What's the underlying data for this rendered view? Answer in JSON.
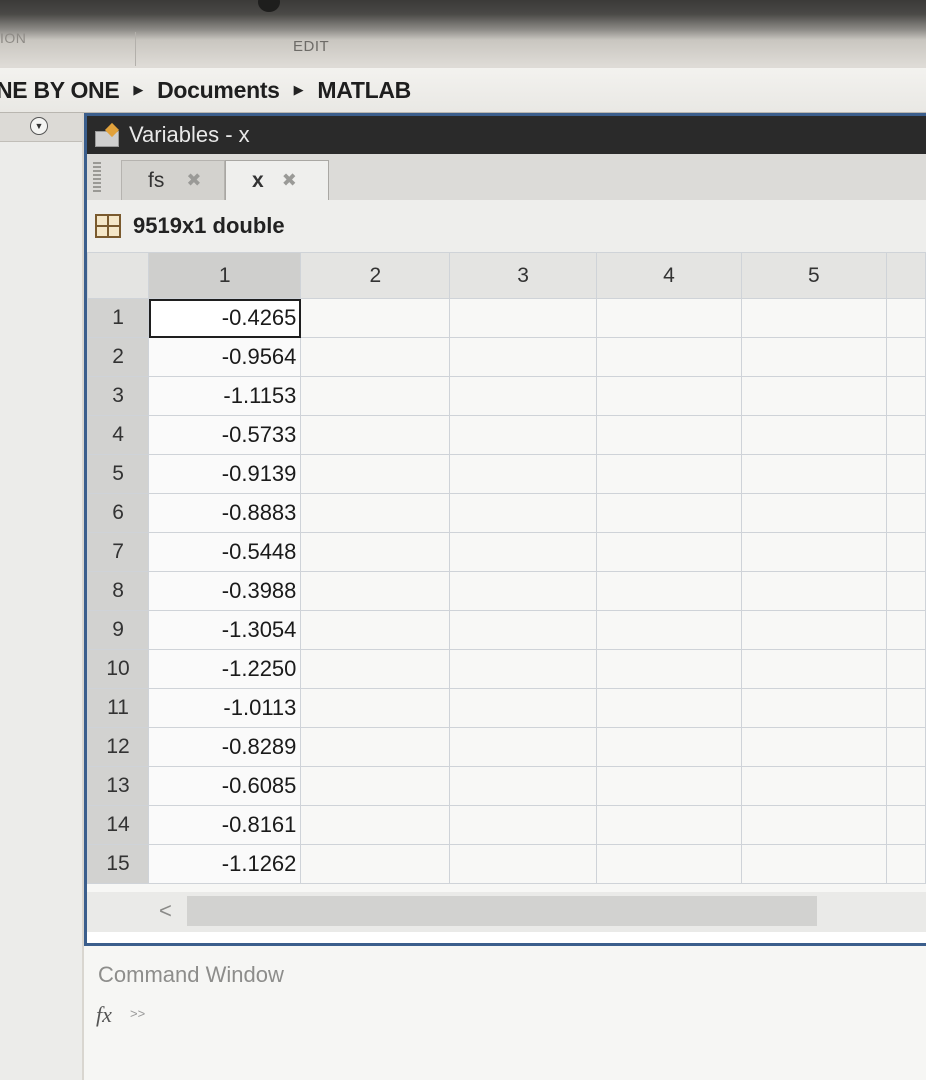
{
  "toolstrip": {
    "section_left": "ION",
    "section_edit": "EDIT"
  },
  "address": {
    "crumbs": [
      "NE BY ONE",
      "Documents",
      "MATLAB"
    ]
  },
  "variables_panel": {
    "title": "Variables - x",
    "tabs": [
      {
        "label": "fs",
        "active": false
      },
      {
        "label": "x",
        "active": true
      }
    ],
    "info": "9519x1 double",
    "columns": [
      "1",
      "2",
      "3",
      "4",
      "5"
    ],
    "rows": [
      {
        "index": "1",
        "value": "-0.4265"
      },
      {
        "index": "2",
        "value": "-0.9564"
      },
      {
        "index": "3",
        "value": "-1.1153"
      },
      {
        "index": "4",
        "value": "-0.5733"
      },
      {
        "index": "5",
        "value": "-0.9139"
      },
      {
        "index": "6",
        "value": "-0.8883"
      },
      {
        "index": "7",
        "value": "-0.5448"
      },
      {
        "index": "8",
        "value": "-0.3988"
      },
      {
        "index": "9",
        "value": "-1.3054"
      },
      {
        "index": "10",
        "value": "-1.2250"
      },
      {
        "index": "11",
        "value": "-1.0113"
      },
      {
        "index": "12",
        "value": "-0.8289"
      },
      {
        "index": "13",
        "value": "-0.6085"
      },
      {
        "index": "14",
        "value": "-0.8161"
      },
      {
        "index": "15",
        "value": "-1.1262"
      }
    ],
    "scroll_left_glyph": "<"
  },
  "command_window": {
    "title": "Command Window",
    "fx_label": "fx",
    "prompt": ">>"
  },
  "colors": {
    "panel_border": "#3b5e8c",
    "title_bar": "#2a2a2a",
    "row_header": "#d2d2d0"
  }
}
